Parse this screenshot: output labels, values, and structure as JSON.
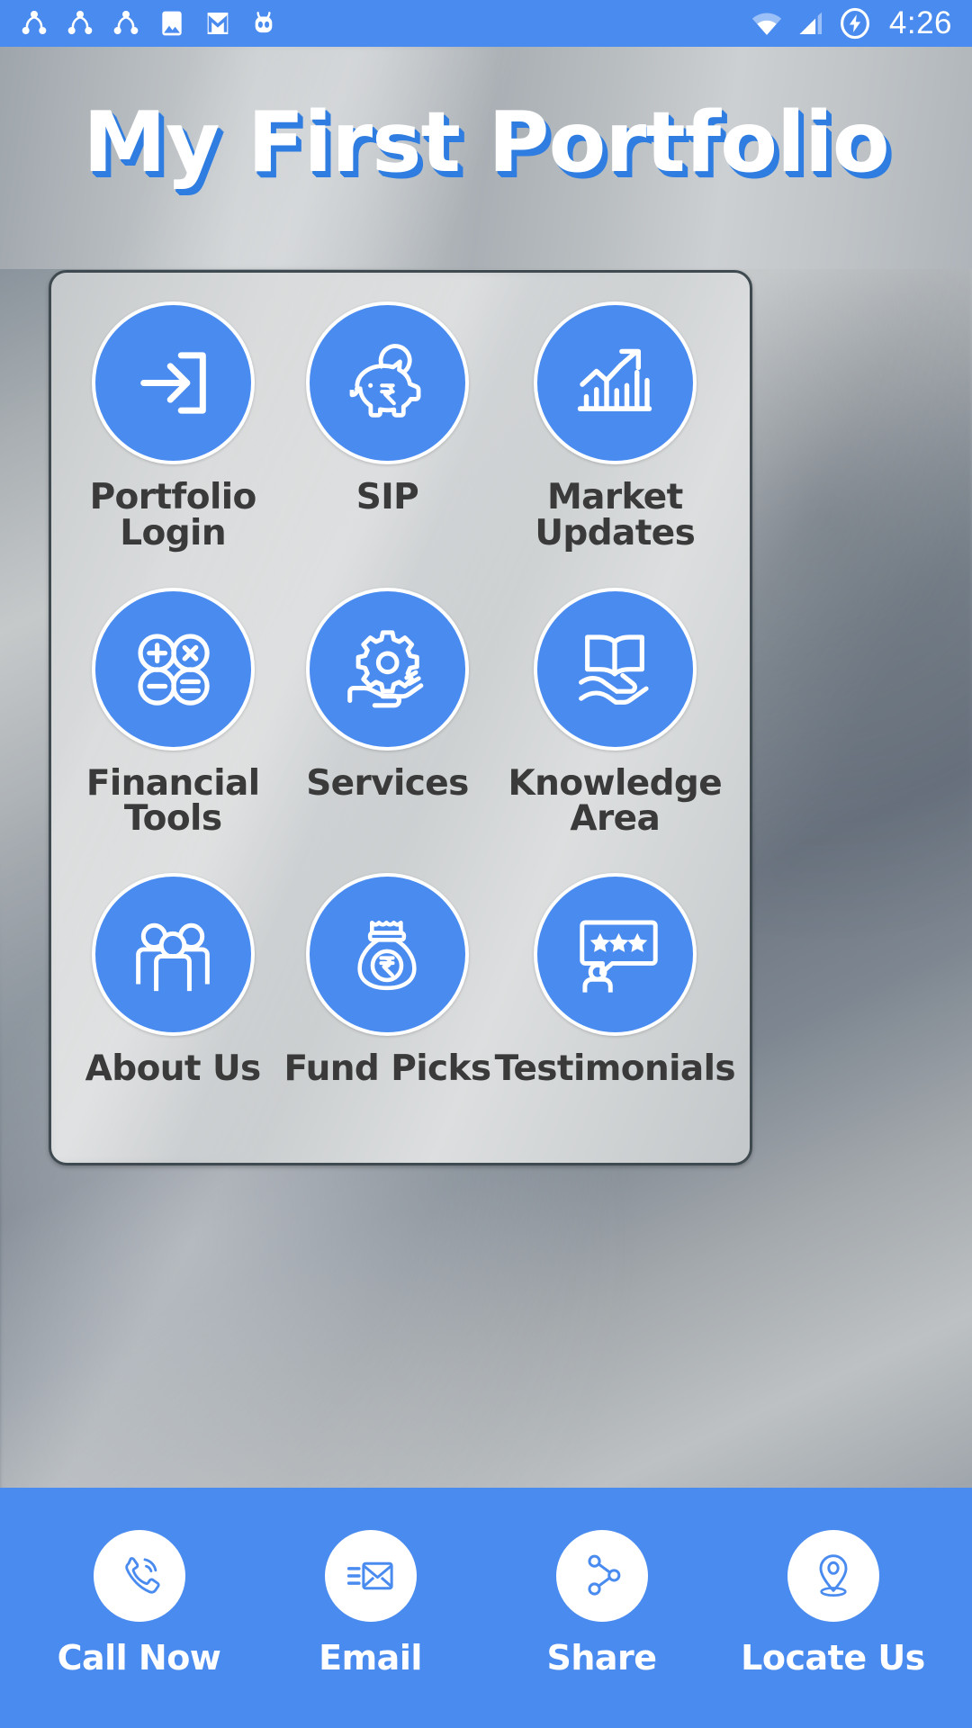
{
  "statusbar": {
    "time": "4:26",
    "left_icons": [
      {
        "name": "share-icon-1",
        "label": "share"
      },
      {
        "name": "share-icon-2",
        "label": "share"
      },
      {
        "name": "share-icon-3",
        "label": "share"
      },
      {
        "name": "gallery-icon",
        "label": "photos"
      },
      {
        "name": "gmail-icon",
        "label": "gmail"
      },
      {
        "name": "cyanogenmod-icon",
        "label": "cyanogenmod"
      }
    ],
    "right_icons": [
      {
        "name": "wifi-icon",
        "label": "wifi"
      },
      {
        "name": "cellular-signal-icon",
        "label": "signal"
      },
      {
        "name": "charging-bolt-icon",
        "label": "charging"
      }
    ]
  },
  "header": {
    "title": "My First Portfolio",
    "title_color": "#ffffff",
    "title_shadow_color": "#2f7de0"
  },
  "theme": {
    "accent": "#4a8bf0",
    "circle_border": "#ffffff",
    "label_color": "#3a3a3a",
    "card_border": "#3e4950"
  },
  "grid": {
    "tiles": [
      {
        "id": "portfolio-login",
        "label": "Portfolio\nLogin",
        "icon": "login-arrow-icon"
      },
      {
        "id": "sip",
        "label": "SIP",
        "icon": "piggy-bank-rupee-icon"
      },
      {
        "id": "market-updates",
        "label": "Market\nUpdates",
        "icon": "bar-chart-growth-icon"
      },
      {
        "id": "financial-tools",
        "label": "Financial\nTools",
        "icon": "calculator-operators-icon"
      },
      {
        "id": "services",
        "label": "Services",
        "icon": "gear-on-hand-icon"
      },
      {
        "id": "knowledge-area",
        "label": "Knowledge\nArea",
        "icon": "book-on-hand-icon"
      },
      {
        "id": "about-us",
        "label": "About Us",
        "icon": "three-people-icon"
      },
      {
        "id": "fund-picks",
        "label": "Fund Picks",
        "icon": "money-bag-rupee-icon"
      },
      {
        "id": "testimonials",
        "label": "Testimonials",
        "icon": "review-stars-speech-icon"
      }
    ]
  },
  "bottombar": {
    "items": [
      {
        "id": "call-now",
        "label": "Call Now",
        "icon": "phone-ring-icon"
      },
      {
        "id": "email",
        "label": "Email",
        "icon": "envelope-icon"
      },
      {
        "id": "share",
        "label": "Share",
        "icon": "share-nodes-icon"
      },
      {
        "id": "locate-us",
        "label": "Locate Us",
        "icon": "map-pin-icon"
      }
    ]
  }
}
